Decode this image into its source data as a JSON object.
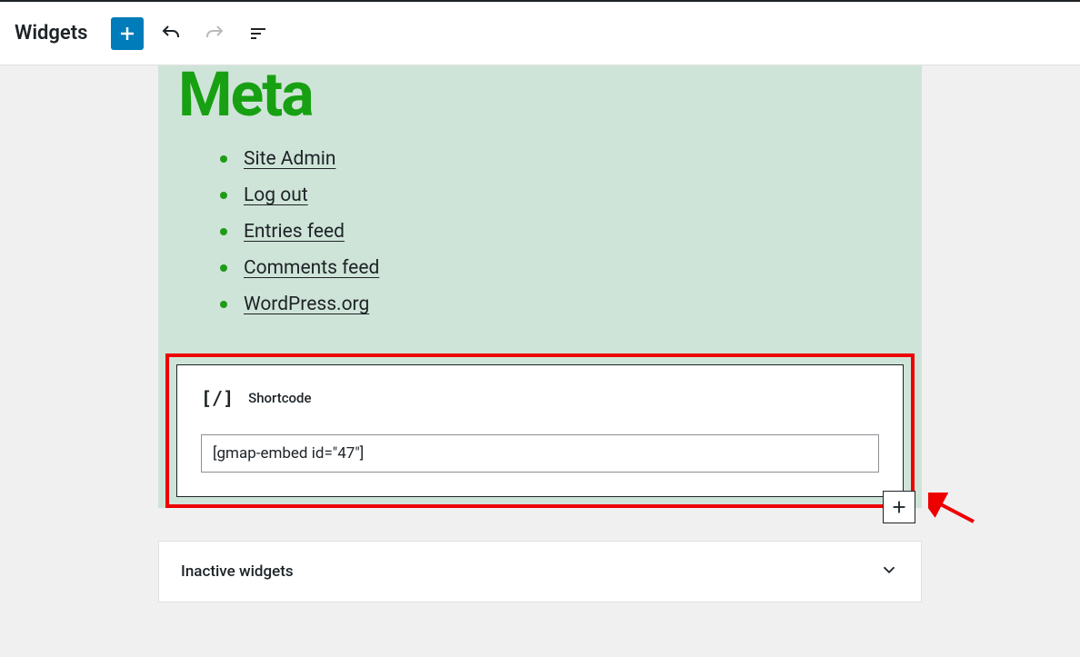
{
  "toolbar": {
    "title": "Widgets"
  },
  "widget": {
    "meta_heading": "Meta",
    "links": [
      "Site Admin",
      "Log out",
      "Entries feed",
      "Comments feed",
      "WordPress.org"
    ]
  },
  "shortcode": {
    "label": "Shortcode",
    "value": "[gmap-embed id=\"47\"]"
  },
  "inactive": {
    "label": "Inactive widgets"
  }
}
